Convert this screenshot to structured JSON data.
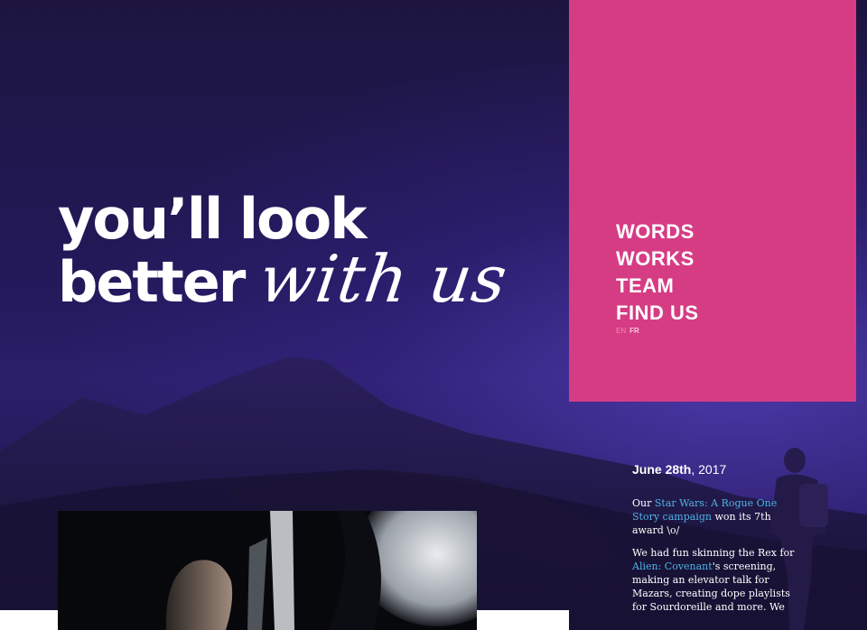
{
  "brand": {
    "vertical_text": ""
  },
  "hero": {
    "line1": "you’ll look",
    "line2_bold": "better",
    "line2_script": "with us"
  },
  "menu": {
    "items": [
      "WORDS",
      "WORKS",
      "TEAM",
      "FIND US"
    ],
    "languages": [
      "EN",
      "FR"
    ]
  },
  "news": {
    "date_bold": "June 28th",
    "date_rest": ", 2017",
    "p1_before": "Our ",
    "p1_link": "Star Wars: A Rogue One Story campaign",
    "p1_after": " won its 7th award \\o/",
    "p2_before": "We had fun skinning the Rex for ",
    "p2_link": "Alien: Covenant",
    "p2_after": "'s screening, making an elevator talk for Mazars, creating dope playlists for Sourdoreille and more. We"
  },
  "colors": {
    "menu_bg": "#d63c84",
    "link": "#4fb3e6",
    "background": "#1a1238"
  }
}
